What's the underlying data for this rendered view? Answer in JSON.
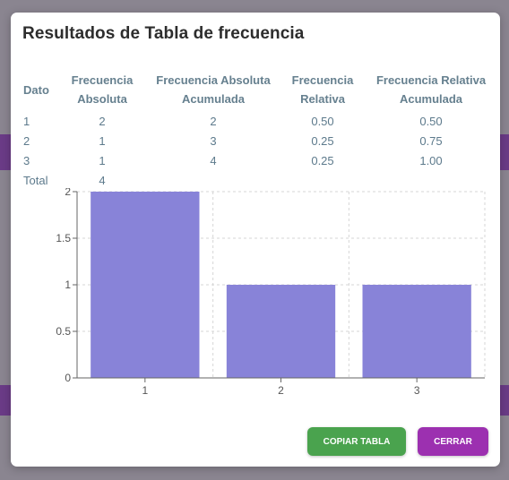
{
  "modal": {
    "title": "Resultados de Tabla de frecuencia"
  },
  "table": {
    "headers": {
      "dato": "Dato",
      "fa_line1": "Frecuencia",
      "fa_line2": "Absoluta",
      "faa_line1": "Frecuencia Absoluta",
      "faa_line2": "Acumulada",
      "fr_line1": "Frecuencia",
      "fr_line2": "Relativa",
      "fra_line1": "Frecuencia Relativa",
      "fra_line2": "Acumulada"
    },
    "rows": [
      {
        "dato": "1",
        "fa": "2",
        "faa": "2",
        "fr": "0.50",
        "fra": "0.50"
      },
      {
        "dato": "2",
        "fa": "1",
        "faa": "3",
        "fr": "0.25",
        "fra": "0.75"
      },
      {
        "dato": "3",
        "fa": "1",
        "faa": "4",
        "fr": "0.25",
        "fra": "1.00"
      }
    ],
    "total": {
      "label": "Total",
      "fa": "4"
    }
  },
  "chart_data": {
    "type": "bar",
    "categories": [
      "1",
      "2",
      "3"
    ],
    "values": [
      2,
      1,
      1
    ],
    "ylim": [
      0,
      2
    ],
    "yticks": [
      "0",
      "0.5",
      "1",
      "1.5",
      "2"
    ],
    "grid": true,
    "bar_color": "#8883d8"
  },
  "buttons": {
    "copy_label": "Copiar tabla",
    "close_label": "Cerrar"
  },
  "colors": {
    "copy_button": "#4aa34e",
    "close_button": "#9c30b0"
  }
}
